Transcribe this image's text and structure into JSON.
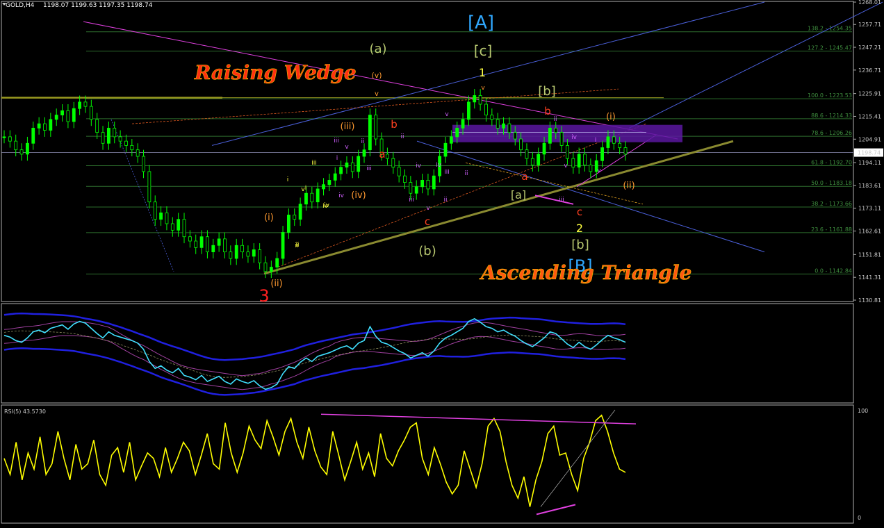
{
  "header": {
    "symbol": "GOLD,H4",
    "ohlc": "1198.07 1199.63 1197.35 1198.74"
  },
  "colors": {
    "background": "#000000",
    "candle_up": "#00ff00",
    "candle_down": "#00ff00",
    "fib": "#2d6e2d",
    "channel": "#4a5fd8",
    "magenta": "#e040e0",
    "wedge_base": "#8a8a30",
    "rsi_line": "#ffff00",
    "zone": "#5a18a0",
    "wave_cyan": "#30a8ff",
    "wave_yellow": "#ffff40",
    "wave_olive": "#b8c870",
    "wave_orange": "#ff9a30",
    "wave_red": "#ff4020",
    "wave_purple": "#d060ff"
  },
  "price_axis": {
    "labels": [
      "1268.01",
      "1257.71",
      "1247.21",
      "1236.71",
      "1225.91",
      "1215.41",
      "1204.91",
      "1194.11",
      "1183.61",
      "1173.11",
      "1162.61",
      "1151.81",
      "1141.31",
      "1130.81"
    ],
    "current_price": "1198.74"
  },
  "fib_levels": [
    {
      "label": "138.2 - 1254.35"
    },
    {
      "label": "127.2 - 1245.47"
    },
    {
      "label": "100.0 - 1223.53"
    },
    {
      "label": "88.6 - 1214.33"
    },
    {
      "label": "78.6 - 1206.26"
    },
    {
      "label": "61.8 - 1192.70"
    },
    {
      "label": "50.0 - 1183.18"
    },
    {
      "label": "38.2 - 1173.66"
    },
    {
      "label": "23.6 - 1161.88"
    },
    {
      "label": "0.0 - 1142.84"
    }
  ],
  "annotations": {
    "raising_wedge": "Raising Wedge",
    "ascending_triangle": "Ascending Triangle",
    "waves": [
      {
        "text": "[A]",
        "color": "#30a8ff"
      },
      {
        "text": "[c]",
        "color": "#b8c870"
      },
      {
        "text": "1",
        "color": "#ffff40"
      },
      {
        "text": "(a)",
        "color": "#b8c870"
      },
      {
        "text": "(v)",
        "color": "#ff9a30"
      },
      {
        "text": "v",
        "color": "#ff9a30"
      },
      {
        "text": "[b]",
        "color": "#b8c870"
      },
      {
        "text": "b",
        "color": "#ff4020"
      },
      {
        "text": "(i)",
        "color": "#ff9a30"
      },
      {
        "text": "(iii)",
        "color": "#ff9a30"
      },
      {
        "text": "b",
        "color": "#ff4020"
      },
      {
        "text": "a",
        "color": "#ff4020"
      },
      {
        "text": "(iv)",
        "color": "#ff9a30"
      },
      {
        "text": "(i)",
        "color": "#ff9a30"
      },
      {
        "text": "c",
        "color": "#ff4020"
      },
      {
        "text": "(b)",
        "color": "#b8c870"
      },
      {
        "text": "a",
        "color": "#ff4020"
      },
      {
        "text": "[a]",
        "color": "#b8c870"
      },
      {
        "text": "c",
        "color": "#ff4020"
      },
      {
        "text": "2",
        "color": "#ffff40"
      },
      {
        "text": "[b]",
        "color": "#b8c870"
      },
      {
        "text": "[B]",
        "color": "#30a8ff"
      },
      {
        "text": "(ii)",
        "color": "#ff9a30"
      },
      {
        "text": "(ii)",
        "color": "#ff9a30"
      },
      {
        "text": "3",
        "color": "#ff2020"
      },
      {
        "text": "v",
        "color": "#d060ff"
      },
      {
        "text": "iii",
        "color": "#d060ff"
      },
      {
        "text": "iv",
        "color": "#d060ff"
      },
      {
        "text": "ii",
        "color": "#d060ff"
      },
      {
        "text": "i",
        "color": "#d060ff"
      },
      {
        "text": "iii",
        "color": "#d060ff"
      },
      {
        "text": "iv",
        "color": "#d060ff"
      },
      {
        "text": "iii",
        "color": "#d060ff"
      },
      {
        "text": "v",
        "color": "#d060ff"
      },
      {
        "text": "ii",
        "color": "#d060ff"
      },
      {
        "text": "iv",
        "color": "#d060ff"
      },
      {
        "text": "v",
        "color": "#d060ff"
      },
      {
        "text": "iii",
        "color": "#d060ff"
      },
      {
        "text": "ii",
        "color": "#d060ff"
      },
      {
        "text": "iv",
        "color": "#d060ff"
      },
      {
        "text": "v",
        "color": "#d060ff"
      },
      {
        "text": "iii",
        "color": "#d060ff"
      },
      {
        "text": "v",
        "color": "#d060ff"
      },
      {
        "text": "v",
        "color": "#ff9a30"
      },
      {
        "text": "ii",
        "color": "#d060ff"
      },
      {
        "text": "i",
        "color": "#d060ff"
      },
      {
        "text": "ii",
        "color": "#d060ff"
      },
      {
        "text": "i",
        "color": "#ffff40"
      },
      {
        "text": "iii",
        "color": "#ffff40"
      },
      {
        "text": "v",
        "color": "#ffff40"
      },
      {
        "text": "ii",
        "color": "#ffff40"
      },
      {
        "text": "iv",
        "color": "#ffff40"
      },
      {
        "text": "i",
        "color": "#ffff40"
      },
      {
        "text": "ii",
        "color": "#ffff40"
      },
      {
        "text": "iv",
        "color": "#ffff40"
      }
    ]
  },
  "rsi": {
    "label": "RSI(5) 43.5730",
    "levels": [
      "100",
      "0"
    ]
  },
  "chart_data": [
    {
      "type": "line",
      "title": "GOLD,H4",
      "ylim": [
        1130.81,
        1268.01
      ],
      "series": [
        {
          "values": [
            1206,
            1204,
            1200,
            1198,
            1203,
            1210,
            1212,
            1209,
            1214,
            1216,
            1218,
            1213,
            1219,
            1222,
            1220,
            1214,
            1208,
            1203,
            1210,
            1206,
            1204,
            1202,
            1200,
            1197,
            1190,
            1176,
            1168,
            1171,
            1166,
            1163,
            1168,
            1160,
            1158,
            1155,
            1160,
            1153,
            1156,
            1159,
            1153,
            1150,
            1156,
            1153,
            1151,
            1154,
            1148,
            1144,
            1146,
            1150,
            1162,
            1170,
            1168,
            1175,
            1180,
            1176,
            1182,
            1184,
            1186,
            1189,
            1192,
            1194,
            1190,
            1197,
            1200,
            1216,
            1205,
            1198,
            1196,
            1192,
            1188,
            1185,
            1180,
            1183,
            1186,
            1182,
            1188,
            1197,
            1203,
            1206,
            1210,
            1214,
            1222,
            1225,
            1221,
            1216,
            1214,
            1210,
            1212,
            1208,
            1205,
            1200,
            1196,
            1193,
            1198,
            1203,
            1210,
            1208,
            1202,
            1196,
            1192,
            1198,
            1193,
            1190,
            1195,
            1201,
            1206,
            1203,
            1201,
            1198
          ]
        }
      ]
    },
    {
      "type": "line",
      "title": "RSI(5) 43.5730",
      "ylim": [
        0,
        100
      ],
      "series": [
        {
          "values": [
            55,
            40,
            70,
            35,
            60,
            45,
            75,
            40,
            50,
            80,
            55,
            35,
            68,
            45,
            50,
            72,
            40,
            30,
            58,
            65,
            42,
            70,
            35,
            48,
            60,
            55,
            38,
            65,
            42,
            55,
            70,
            62,
            40,
            58,
            78,
            50,
            45,
            88,
            60,
            42,
            60,
            85,
            72,
            64,
            90,
            75,
            58,
            80,
            92,
            70,
            55,
            84,
            62,
            47,
            40,
            80,
            58,
            35,
            52,
            70,
            45,
            60,
            38,
            78,
            55,
            48,
            62,
            72,
            84,
            88,
            55,
            40,
            65,
            50,
            33,
            22,
            30,
            62,
            45,
            28,
            50,
            85,
            92,
            80,
            52,
            30,
            18,
            38,
            10,
            35,
            52,
            78,
            85,
            58,
            60,
            40,
            25,
            55,
            70,
            90,
            95,
            80,
            60,
            45,
            42
          ]
        }
      ]
    }
  ]
}
